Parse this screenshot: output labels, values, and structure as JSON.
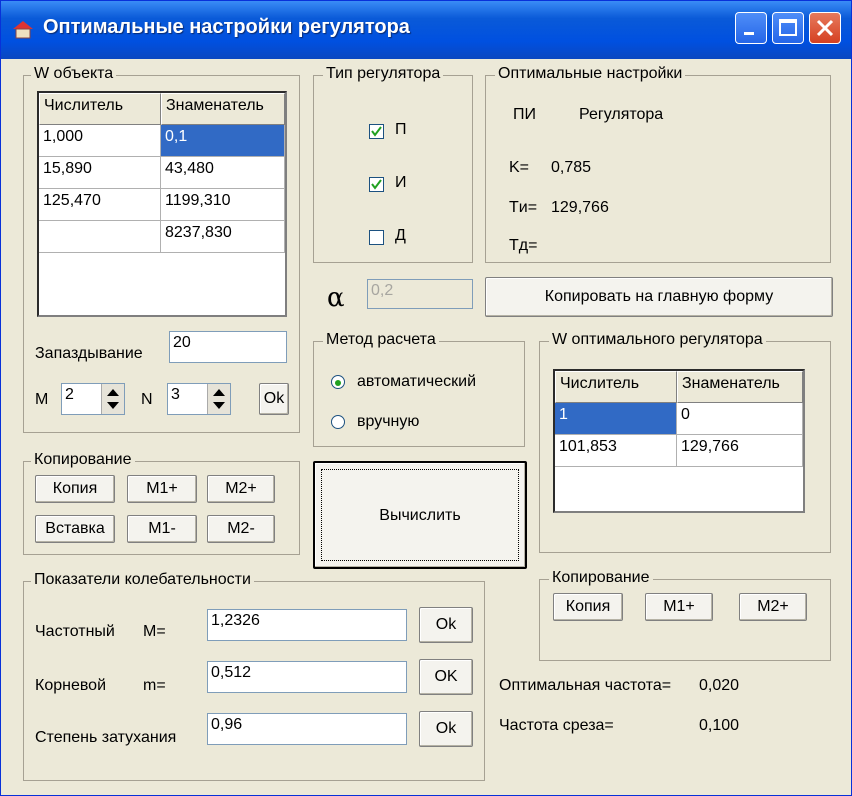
{
  "window": {
    "title": "Оптимальные настройки регулятора"
  },
  "object_group": {
    "legend": "W объекта",
    "headers": [
      "Числитель",
      "Знаменатель"
    ],
    "rows": [
      [
        "1,000",
        "0,1"
      ],
      [
        "15,890",
        "43,480"
      ],
      [
        "125,470",
        "1199,310"
      ],
      [
        "",
        "8237,830"
      ]
    ],
    "delay_label": "Запаздывание",
    "delay_value": "20",
    "m_label": "M",
    "m_value": "2",
    "n_label": "N",
    "n_value": "3",
    "ok_label": "Ok"
  },
  "reg_type": {
    "legend": "Тип регулятора",
    "options": [
      {
        "label": "П",
        "checked": true
      },
      {
        "label": "И",
        "checked": true
      },
      {
        "label": "Д",
        "checked": false
      }
    ]
  },
  "optimal_settings": {
    "legend": "Оптимальные настройки",
    "type_short": "ПИ",
    "type_word": "Регулятора",
    "k_label": "K=",
    "k_value": "0,785",
    "ti_label": "Tи=",
    "ti_value": "129,766",
    "td_label": "Tд="
  },
  "alpha": {
    "symbol": "α",
    "value": "0,2"
  },
  "copy_main_button": "Копировать на главную форму",
  "method": {
    "legend": "Метод расчета",
    "options": [
      {
        "label": "автоматический",
        "selected": true
      },
      {
        "label": "вручную",
        "selected": false
      }
    ]
  },
  "compute_button": "Вычислить",
  "regulator_group": {
    "legend": "W оптимального регулятора",
    "headers": [
      "Числитель",
      "Знаменатель"
    ],
    "rows": [
      [
        "1",
        "0"
      ],
      [
        "101,853",
        "129,766"
      ]
    ]
  },
  "copy_left": {
    "legend": "Копирование",
    "buttons": [
      "Копия",
      "M1+",
      "M2+",
      "Вставка",
      "M1-",
      "M2-"
    ]
  },
  "copy_right": {
    "legend": "Копирование",
    "buttons": [
      "Копия",
      "M1+",
      "M2+"
    ]
  },
  "oscillation": {
    "legend": "Показатели колебательности",
    "rows": [
      {
        "label": "Частотный",
        "sym": "M=",
        "value": "1,2326",
        "ok": "Ok"
      },
      {
        "label": "Корневой",
        "sym": "m=",
        "value": "0,512",
        "ok": "OK"
      },
      {
        "label": "Степень затухания",
        "sym": "",
        "value": "0,96",
        "ok": "Ok"
      }
    ]
  },
  "freq": {
    "optimal_label": "Оптимальная частота=",
    "optimal_value": "0,020",
    "cutoff_label": "Частота среза=",
    "cutoff_value": "0,100"
  }
}
